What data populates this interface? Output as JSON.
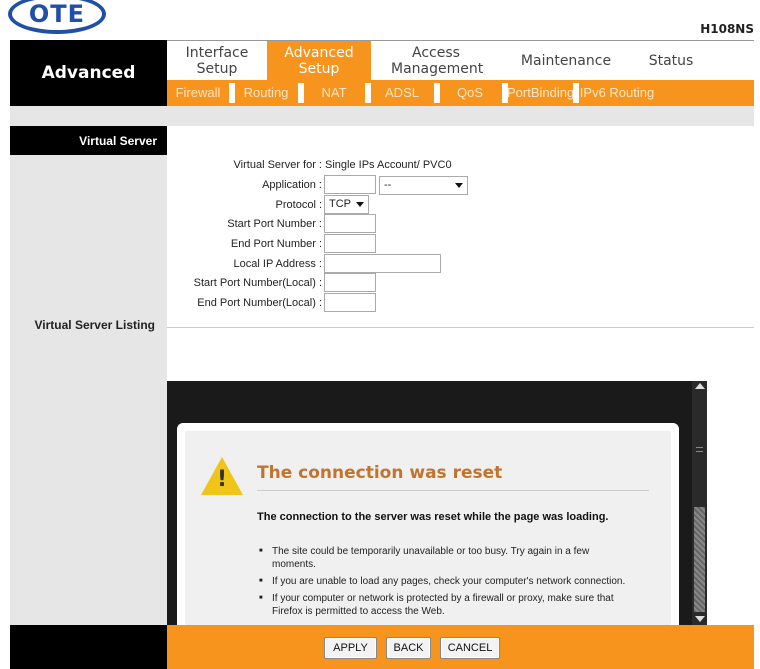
{
  "logo": {
    "text": "OTE"
  },
  "model": "H108NS",
  "section_title": "Advanced",
  "main_nav": [
    {
      "label": "Interface Setup",
      "active": false
    },
    {
      "label": "Advanced Setup",
      "active": true
    },
    {
      "label": "Access Management",
      "active": false
    },
    {
      "label": "Maintenance",
      "active": false
    },
    {
      "label": "Status",
      "active": false
    }
  ],
  "sub_nav": [
    "Firewall",
    "Routing",
    "NAT",
    "ADSL",
    "QoS",
    "PortBinding",
    "IPv6 Routing"
  ],
  "virtual_server": {
    "heading": "Virtual Server",
    "for_label": "Virtual Server for :",
    "for_value": "Single IPs Account/ PVC0",
    "application_label": "Application :",
    "application_value": "",
    "application_select": "--",
    "protocol_label": "Protocol :",
    "protocol_value": "TCP",
    "start_port_label": "Start Port Number :",
    "start_port_value": "",
    "end_port_label": "End Port Number :",
    "end_port_value": "",
    "local_ip_label": "Local IP Address :",
    "local_ip_value": "",
    "start_port_local_label": "Start Port Number(Local) :",
    "start_port_local_value": "",
    "end_port_local_label": "End Port Number(Local) :",
    "end_port_local_value": ""
  },
  "listing_label": "Virtual Server Listing",
  "error": {
    "title": "The connection was reset",
    "subtitle": "The connection to the server was reset while the page was loading.",
    "bullets": [
      "The site could be temporarily unavailable or too busy. Try again in a few moments.",
      "If you are unable to load any pages, check your computer's network connection.",
      "If your computer or network is protected by a firewall or proxy, make sure that Firefox is permitted to access the Web."
    ]
  },
  "buttons": {
    "apply": "APPLY",
    "back": "BACK",
    "cancel": "CANCEL"
  },
  "colors": {
    "accent": "#f7941d",
    "brand": "#1f4fa8",
    "error_title": "#c3742c"
  }
}
